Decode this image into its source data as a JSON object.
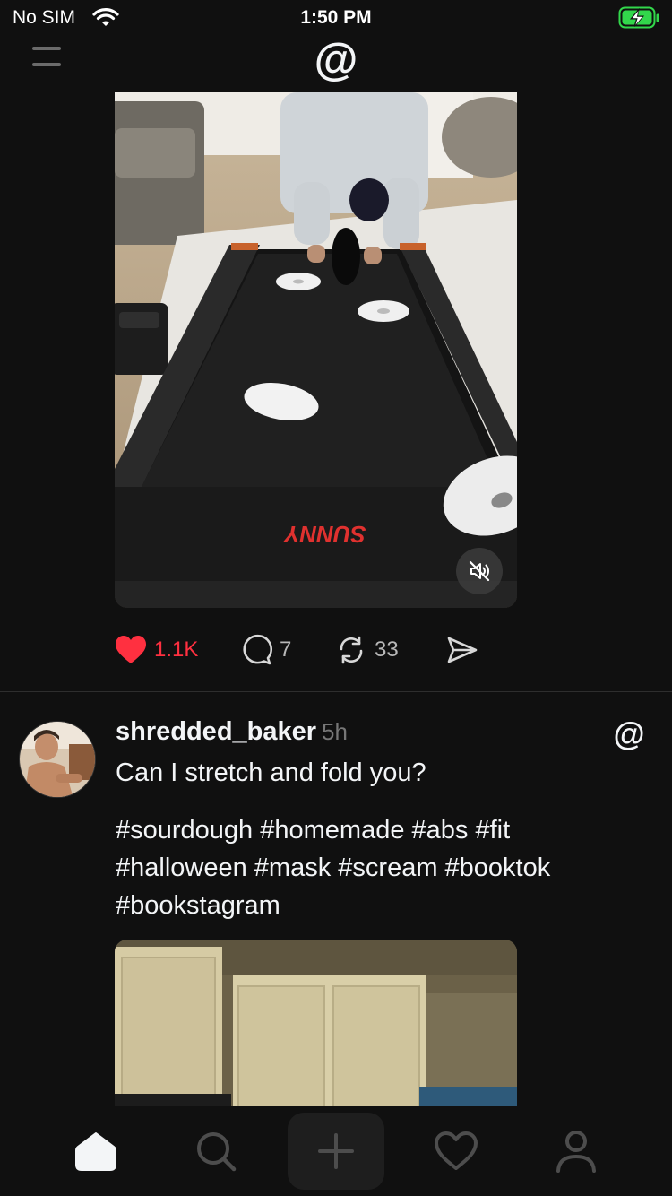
{
  "status_bar": {
    "carrier": "No SIM",
    "time": "1:50 PM",
    "battery_state": "charging",
    "accent_color": "#32d74b"
  },
  "header": {
    "menu_icon": "hamburger-icon",
    "logo_icon": "threads-logo-icon"
  },
  "first_post": {
    "media_description": "treadmill-video",
    "media_brand_text": "SUNNY",
    "muted": true,
    "actions": {
      "like_count": "1.1K",
      "reply_count": "7",
      "repost_count": "33",
      "liked": true,
      "like_color": "#ff3040"
    }
  },
  "second_post": {
    "username": "shredded_baker",
    "age": "5h",
    "text": "Can I stretch and fold you?",
    "hashtags": [
      "#sourdough",
      "#homemade",
      "#abs",
      "#fit",
      "#halloween",
      "#mask",
      "#scream",
      "#booktok",
      "#bookstagram"
    ]
  },
  "tab_bar": {
    "tabs": [
      {
        "icon": "home-icon",
        "active": true
      },
      {
        "icon": "search-icon",
        "active": false
      },
      {
        "icon": "plus-icon",
        "active": false
      },
      {
        "icon": "heart-icon",
        "active": false
      },
      {
        "icon": "profile-icon",
        "active": false
      }
    ]
  }
}
